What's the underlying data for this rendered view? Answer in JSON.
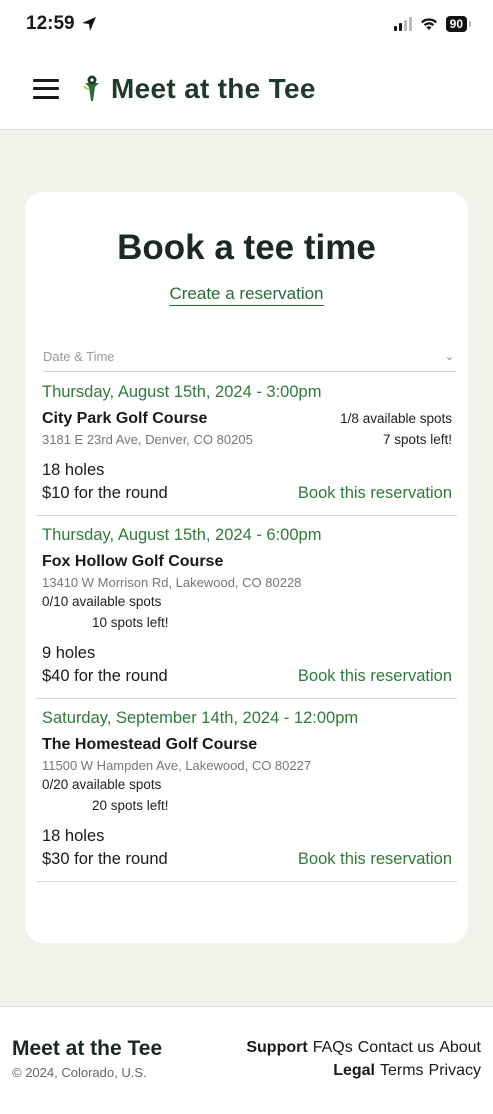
{
  "status_bar": {
    "time": "12:59",
    "battery": "90"
  },
  "header": {
    "brand": "Meet at the Tee"
  },
  "card": {
    "title": "Book a tee time",
    "subtitle": "Create a reservation",
    "filter_label": "Date & Time",
    "reservations": [
      {
        "date": "Thursday, August 15th, 2024 - 3:00pm",
        "course": "City Park Golf Course",
        "address": "3181 E 23rd Ave, Denver, CO 80205",
        "available": "1/8 available spots",
        "left": "7 spots left!",
        "holes": "18 holes",
        "price": "$10 for the round",
        "book": "Book this reservation"
      },
      {
        "date": "Thursday, August 15th, 2024 - 6:00pm",
        "course": "Fox Hollow Golf Course",
        "address": "13410 W Morrison Rd, Lakewood, CO 80228",
        "available": "0/10 available spots",
        "left": "10 spots left!",
        "holes": "9 holes",
        "price": "$40 for the round",
        "book": "Book this reservation"
      },
      {
        "date": "Saturday, September 14th, 2024 - 12:00pm",
        "course": "The Homestead Golf Course",
        "address": "11500 W Hampden Ave, Lakewood, CO 80227",
        "available": "0/20 available spots",
        "left": "20 spots left!",
        "holes": "18 holes",
        "price": "$30 for the round",
        "book": "Book this reservation"
      }
    ]
  },
  "footer": {
    "brand": "Meet at the Tee",
    "copyright": "© 2024, Colorado, U.S.",
    "support_heading": "Support",
    "support_links": [
      "FAQs",
      "Contact us",
      "About"
    ],
    "legal_heading": "Legal",
    "legal_links": [
      "Terms",
      "Privacy"
    ]
  }
}
